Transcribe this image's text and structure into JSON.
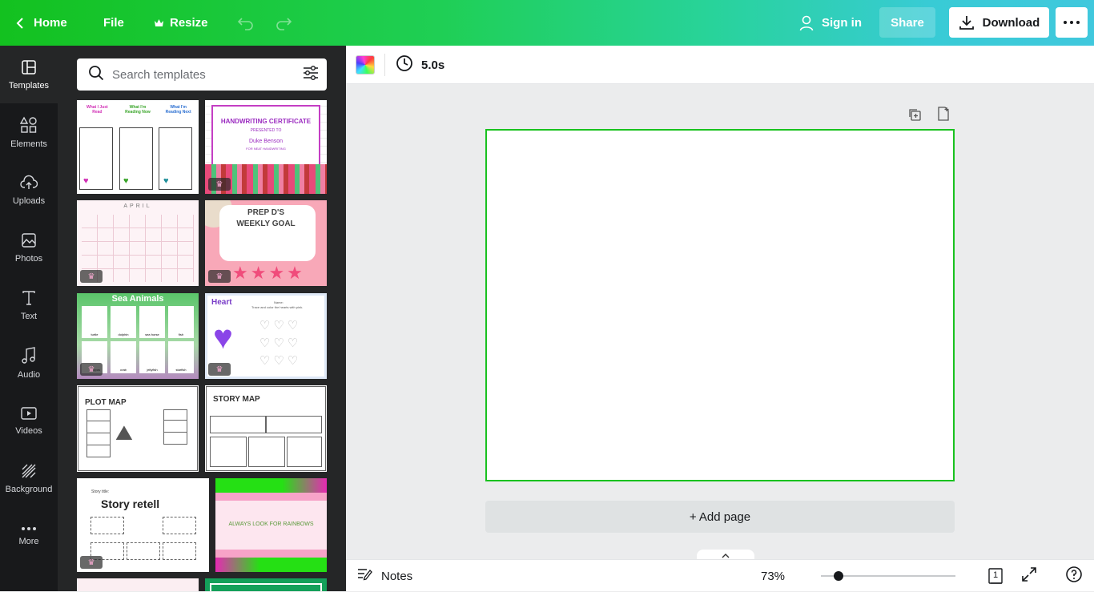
{
  "topbar": {
    "home_label": "Home",
    "file_label": "File",
    "resize_label": "Resize",
    "signin_label": "Sign in",
    "share_label": "Share",
    "download_label": "Download"
  },
  "rail": {
    "items": [
      {
        "label": "Templates",
        "icon": "templates-icon"
      },
      {
        "label": "Elements",
        "icon": "elements-icon"
      },
      {
        "label": "Uploads",
        "icon": "uploads-icon"
      },
      {
        "label": "Photos",
        "icon": "photos-icon"
      },
      {
        "label": "Text",
        "icon": "text-icon"
      },
      {
        "label": "Audio",
        "icon": "audio-icon"
      },
      {
        "label": "Videos",
        "icon": "videos-icon"
      },
      {
        "label": "Background",
        "icon": "background-icon"
      },
      {
        "label": "More",
        "icon": "more-icon"
      }
    ]
  },
  "search": {
    "placeholder": "Search templates"
  },
  "templates": {
    "t1": {
      "cols": [
        "What I Just Read",
        "What I'm Reading Now",
        "What I'm Reading Next"
      ]
    },
    "t2": {
      "title": "HANDWRITING CERTIFICATE",
      "presented": "PRESENTED TO",
      "name": "Duke Benson",
      "sub": "FOR NEAT HANDWRITING"
    },
    "t3": {
      "title": "APRIL"
    },
    "t4": {
      "title": "PREP D'S",
      "title2": "WEEKLY GOAL"
    },
    "t5": {
      "title": "Sea Animals",
      "labels": [
        "turtle",
        "dolphin",
        "sea horse",
        "fish",
        "octopus",
        "crab",
        "jellyfish",
        "starfish"
      ]
    },
    "t6": {
      "title": "Heart",
      "name": "Name:",
      "instr": "Trace and color the hearts with pink."
    },
    "t7": {
      "title": "PLOT MAP"
    },
    "t8": {
      "title": "STORY MAP"
    },
    "t9": {
      "title": "Story retell",
      "small": "Story title:"
    },
    "t10": {
      "title": "ALWAYS LOOK FOR RAINBOWS"
    }
  },
  "subbar": {
    "duration": "5.0s"
  },
  "canvas": {
    "add_page_label": "+ Add page"
  },
  "bottombar": {
    "notes_label": "Notes",
    "zoom": "73%",
    "zoom_level": 0.13,
    "page_count": "1"
  },
  "colors": {
    "accent": "#19c21f",
    "topbar_start": "#13c11f",
    "topbar_end": "#40c8dd"
  }
}
